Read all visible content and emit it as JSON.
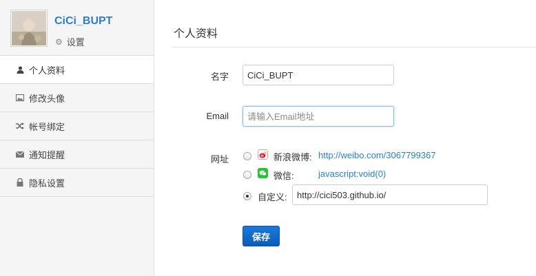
{
  "profile": {
    "username": "CiCi_BUPT",
    "settings_label": "设置"
  },
  "sidebar": {
    "items": [
      {
        "label": "个人资料",
        "icon": "user-icon",
        "active": true
      },
      {
        "label": "修改头像",
        "icon": "image-icon",
        "active": false
      },
      {
        "label": "帐号绑定",
        "icon": "shuffle-icon",
        "active": false
      },
      {
        "label": "通知提醒",
        "icon": "envelope-icon",
        "active": false
      },
      {
        "label": "隐私设置",
        "icon": "lock-icon",
        "active": false
      }
    ]
  },
  "main": {
    "title": "个人资料",
    "name_label": "名字",
    "name_value": "CiCi_BUPT",
    "email_label": "Email",
    "email_placeholder": "请输入Email地址",
    "website_label": "网址",
    "options": {
      "weibo_label": "新浪微博:",
      "weibo_url": "http://weibo.com/3067799367",
      "wechat_label": "微信:",
      "wechat_url": "javascript:void(0)",
      "custom_label": "自定义:",
      "custom_value": "http://cici503.github.io/"
    },
    "selected_option": "custom",
    "save_label": "保存"
  },
  "colors": {
    "accent": "#2d7fc1",
    "button": "#0b5cb8",
    "sidebar_bg": "#f5f5f5",
    "wechat_green": "#2dbf3a"
  }
}
